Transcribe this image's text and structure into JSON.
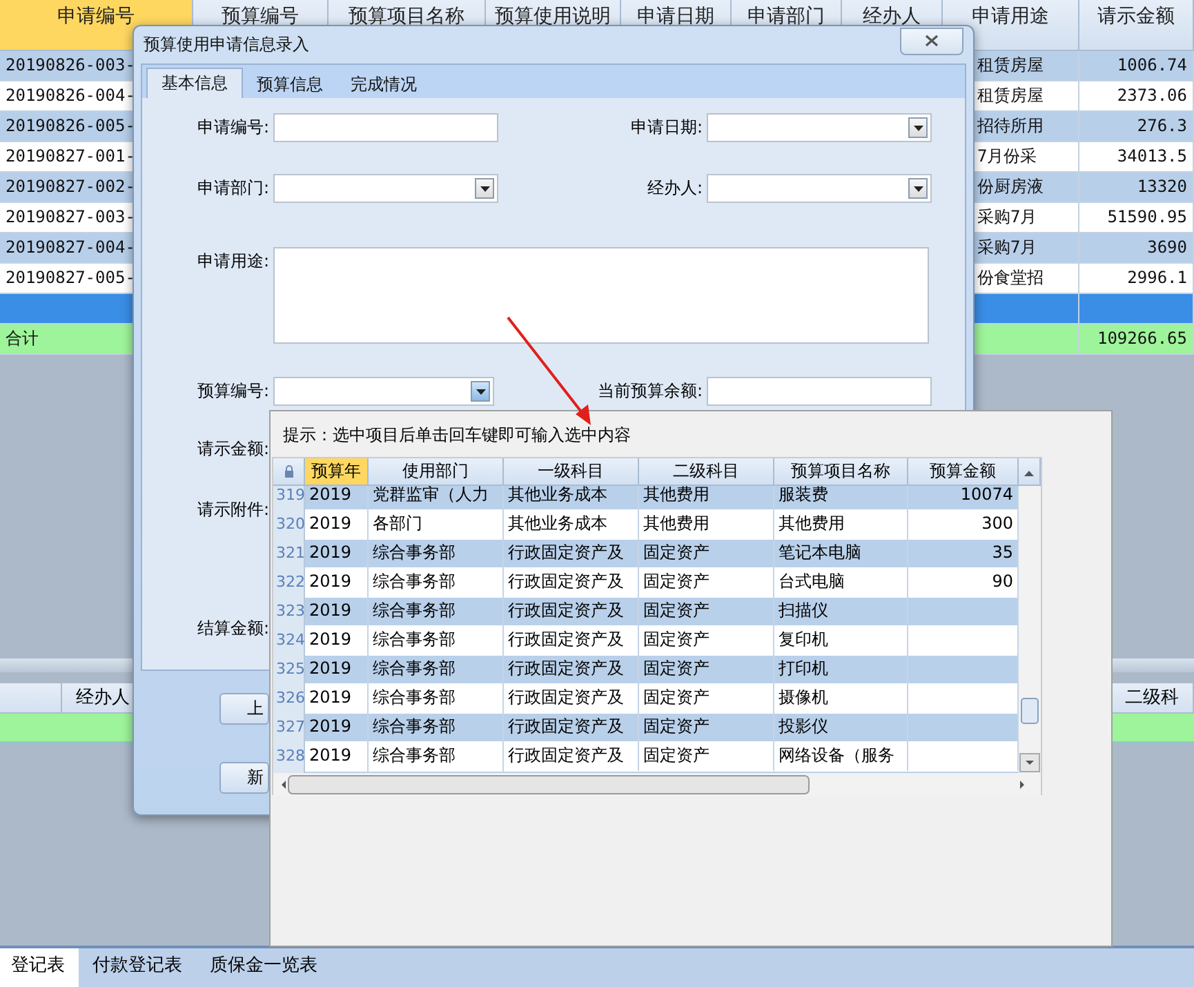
{
  "main_table": {
    "columns": [
      {
        "label": "申请编号",
        "selected": true
      },
      {
        "label": "预算编号",
        "selected": false
      },
      {
        "label": "预算项目名称",
        "selected": false
      },
      {
        "label": "预算使用说明",
        "selected": false
      },
      {
        "label": "申请日期",
        "selected": false
      },
      {
        "label": "申请部门",
        "selected": false
      },
      {
        "label": "经办人",
        "selected": false
      },
      {
        "label": "申请用途",
        "selected": false
      },
      {
        "label": "请示金额",
        "selected": false
      }
    ],
    "rows": [
      {
        "request_no": "20190826-003-",
        "purpose": "租赁房屋",
        "amount": "1006.74",
        "selected": false
      },
      {
        "request_no": "20190826-004-",
        "purpose": "租赁房屋",
        "amount": "2373.06",
        "selected": false
      },
      {
        "request_no": "20190826-005-",
        "purpose": "招待所用",
        "amount": "276.3",
        "selected": false
      },
      {
        "request_no": "20190827-001-",
        "purpose": "7月份采",
        "amount": "34013.5",
        "selected": false
      },
      {
        "request_no": "20190827-002-",
        "purpose": "份厨房液",
        "amount": "13320",
        "selected": false
      },
      {
        "request_no": "20190827-003-",
        "purpose": "采购7月",
        "amount": "51590.95",
        "selected": false
      },
      {
        "request_no": "20190827-004-",
        "purpose": "采购7月",
        "amount": "3690",
        "selected": false
      },
      {
        "request_no": "20190827-005-",
        "purpose": "份食堂招",
        "amount": "2996.1",
        "selected": false
      },
      {
        "selected": true
      }
    ],
    "total": {
      "label": "合计",
      "amount": "109266.65"
    }
  },
  "lower_table": {
    "columns": [
      "经办人",
      "二级科"
    ]
  },
  "sheet_tabs": [
    {
      "label": "登记表",
      "selected": true
    },
    {
      "label": "付款登记表",
      "selected": false
    },
    {
      "label": "质保金一览表",
      "selected": false
    }
  ],
  "dialog": {
    "title": "预算使用申请信息录入",
    "tabs": [
      {
        "label": "基本信息",
        "selected": true
      },
      {
        "label": "预算信息",
        "selected": false
      },
      {
        "label": "完成情况",
        "selected": false
      }
    ],
    "rows": [
      [
        {
          "label": "申请编号:",
          "kind": "text"
        },
        {
          "label": "申请日期:",
          "kind": "combo",
          "active": false
        }
      ],
      [
        {
          "label": "申请部门:",
          "kind": "combo",
          "active": false
        },
        {
          "label": "经办人:",
          "kind": "combo",
          "active": false
        }
      ],
      [
        {
          "label": "申请用途:",
          "kind": "textarea"
        }
      ],
      [
        {
          "label": "预算编号:",
          "kind": "combo",
          "active": true
        },
        {
          "label": "当前预算余额:",
          "kind": "text"
        }
      ],
      [
        {
          "label": "请示金额:",
          "kind": "label"
        }
      ],
      [
        {
          "label": "请示附件:",
          "kind": "label"
        }
      ],
      [
        {
          "label": "结算金额:",
          "kind": "label"
        }
      ]
    ],
    "buttons": [
      "上",
      "新"
    ]
  },
  "popup": {
    "hint": "提示：选中项目后单击回车键即可输入选中内容",
    "columns": [
      {
        "label": "预算年",
        "selected": true
      },
      {
        "label": "使用部门",
        "selected": false
      },
      {
        "label": "一级科目",
        "selected": false
      },
      {
        "label": "二级科目",
        "selected": false
      },
      {
        "label": "预算项目名称",
        "selected": false
      },
      {
        "label": "预算金额",
        "selected": false
      }
    ],
    "rows": [
      {
        "number": "319",
        "cells": [
          "2019",
          "党群监审（人力",
          "其他业务成本",
          "其他费用",
          "服装费",
          "10074"
        ]
      },
      {
        "number": "320",
        "cells": [
          "2019",
          "各部门",
          "其他业务成本",
          "其他费用",
          "其他费用",
          "300"
        ]
      },
      {
        "number": "321",
        "cells": [
          "2019",
          "综合事务部",
          "行政固定资产及",
          "固定资产",
          "笔记本电脑",
          "35"
        ]
      },
      {
        "number": "322",
        "cells": [
          "2019",
          "综合事务部",
          "行政固定资产及",
          "固定资产",
          "台式电脑",
          "90"
        ]
      },
      {
        "number": "323",
        "cells": [
          "2019",
          "综合事务部",
          "行政固定资产及",
          "固定资产",
          "扫描仪"
        ]
      },
      {
        "number": "324",
        "cells": [
          "2019",
          "综合事务部",
          "行政固定资产及",
          "固定资产",
          "复印机"
        ]
      },
      {
        "number": "325",
        "cells": [
          "2019",
          "综合事务部",
          "行政固定资产及",
          "固定资产",
          "打印机"
        ]
      },
      {
        "number": "326",
        "cells": [
          "2019",
          "综合事务部",
          "行政固定资产及",
          "固定资产",
          "摄像机"
        ]
      },
      {
        "number": "327",
        "cells": [
          "2019",
          "综合事务部",
          "行政固定资产及",
          "固定资产",
          "投影仪"
        ]
      },
      {
        "number": "328",
        "cells": [
          "2019",
          "综合事务部",
          "行政固定资产及",
          "固定资产",
          "网络设备（服务"
        ]
      }
    ]
  }
}
